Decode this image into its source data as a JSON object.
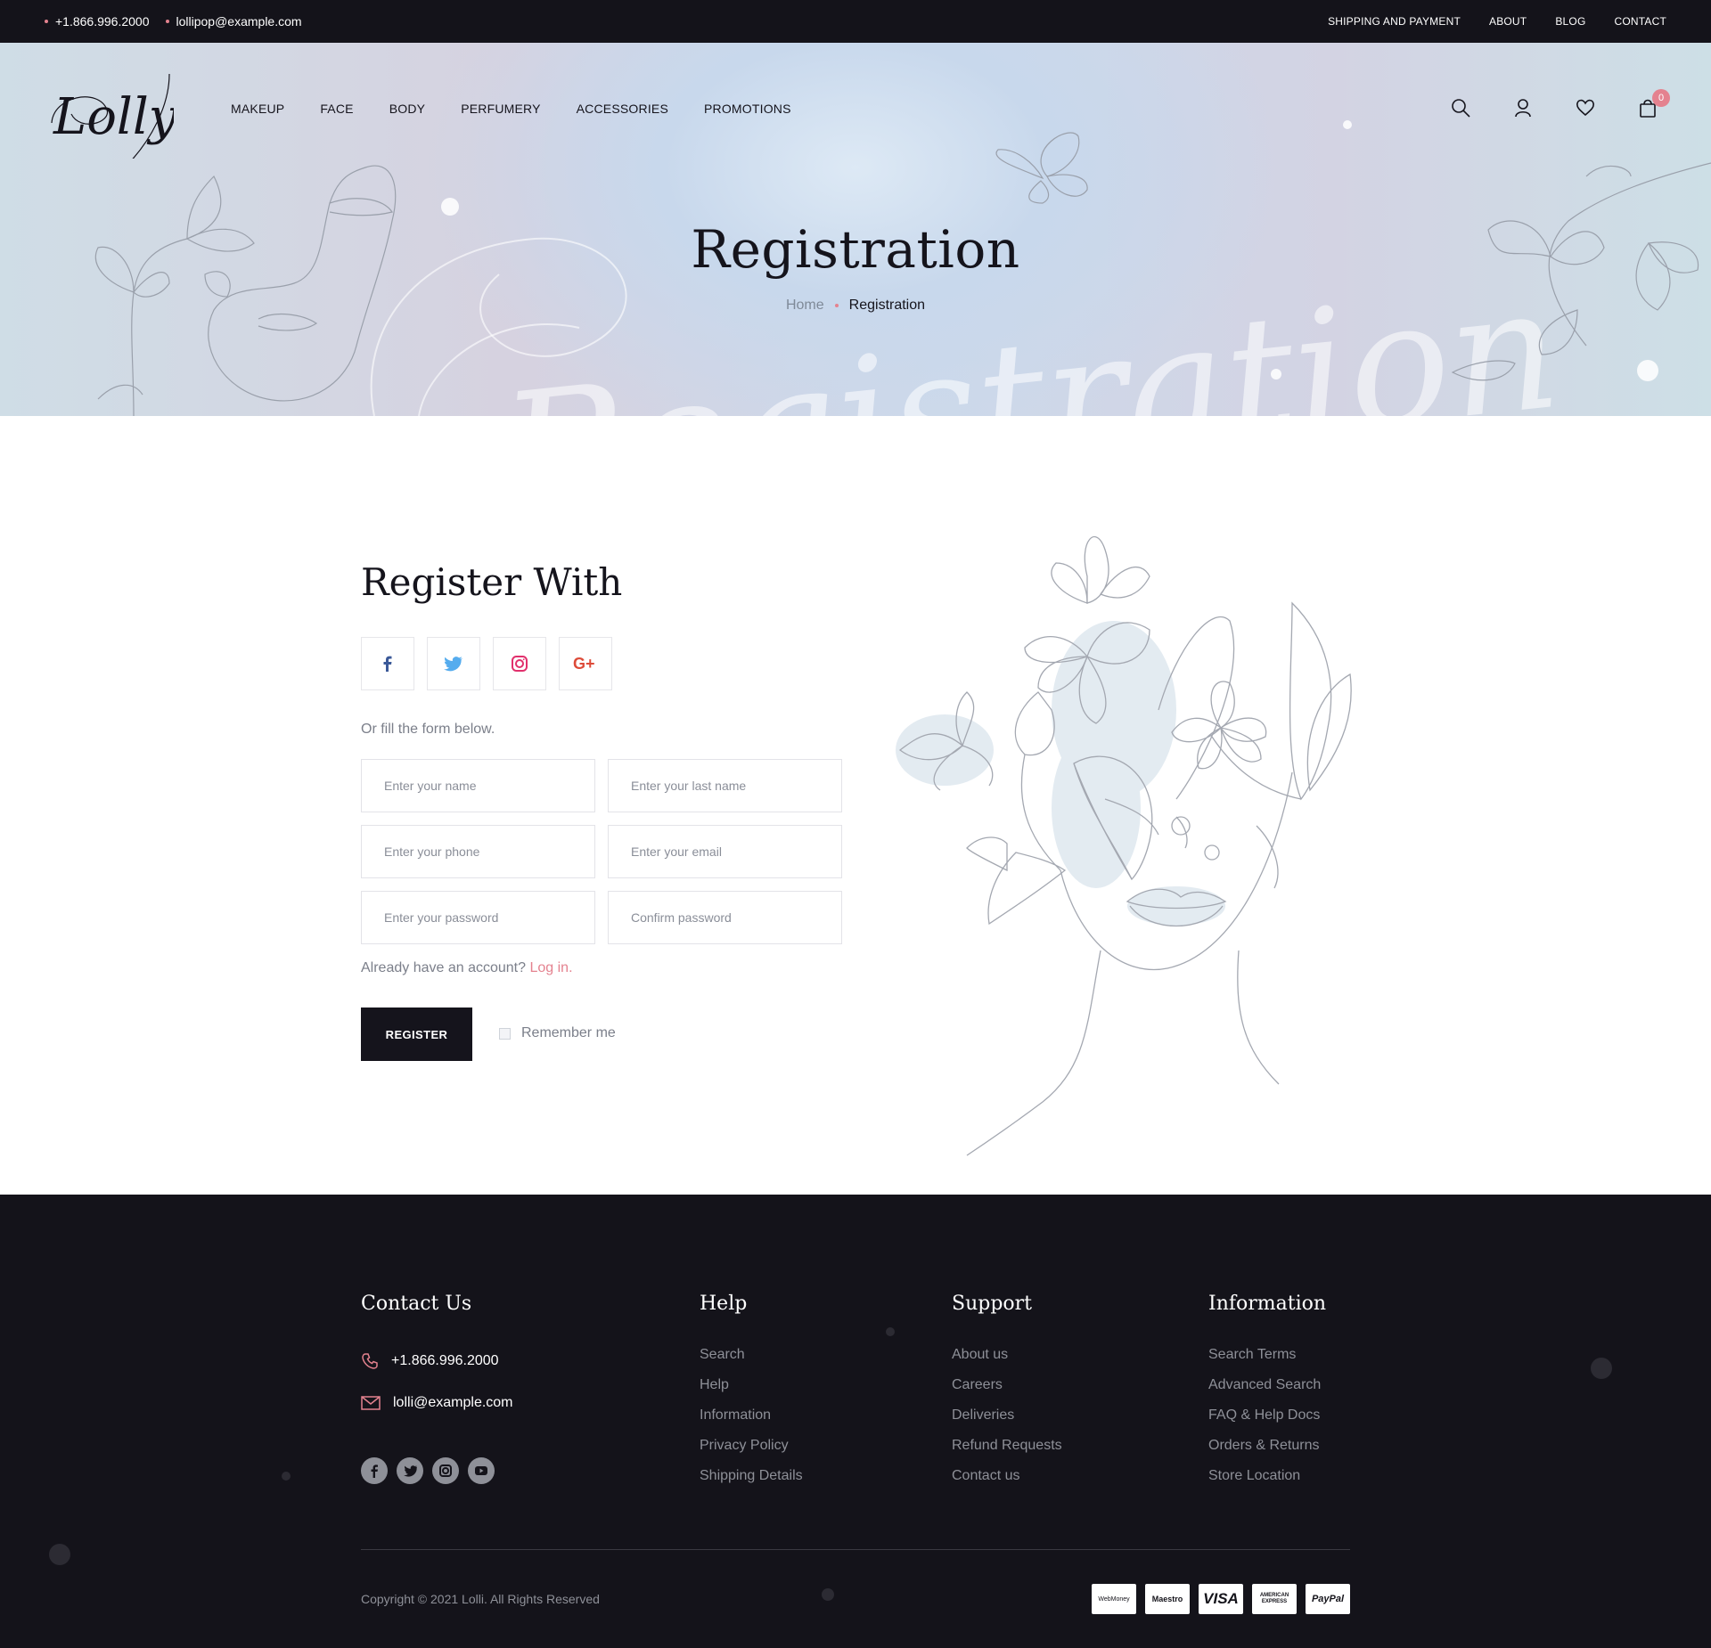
{
  "topbar": {
    "phone": "+1.866.996.2000",
    "email": "lollipop@example.com",
    "links": [
      "SHIPPING AND PAYMENT",
      "ABOUT",
      "BLOG",
      "CONTACT"
    ]
  },
  "header": {
    "logo_text": "Lolly",
    "nav": [
      "MAKEUP",
      "FACE",
      "BODY",
      "PERFUMERY",
      "ACCESSORIES",
      "PROMOTIONS"
    ],
    "icons": [
      "search-icon",
      "user-icon",
      "heart-icon",
      "cart-icon"
    ],
    "cart_count": "0"
  },
  "hero": {
    "title": "Registration",
    "watermark": "Registration",
    "breadcrumb_home": "Home",
    "breadcrumb_current": "Registration"
  },
  "register": {
    "title": "Register With",
    "social": [
      "facebook-icon",
      "twitter-icon",
      "instagram-icon",
      "google-plus-icon"
    ],
    "note": "Or fill the form below.",
    "fields": {
      "name": "Enter your name",
      "last_name": "Enter your last name",
      "phone": "Enter your phone",
      "email": "Enter your email",
      "password": "Enter your password",
      "confirm": "Confirm password"
    },
    "have_account": "Already have an account?",
    "login": "Log in.",
    "button": "REGISTER",
    "remember": "Remember me"
  },
  "footer": {
    "contact": {
      "title": "Contact Us",
      "phone": "+1.866.996.2000",
      "email": "lolli@example.com"
    },
    "help": {
      "title": "Help",
      "items": [
        "Search",
        "Help",
        "Information",
        "Privacy Policy",
        "Shipping Details"
      ]
    },
    "support": {
      "title": "Support",
      "items": [
        "About us",
        "Careers",
        "Deliveries",
        "Refund Requests",
        "Contact us"
      ]
    },
    "information": {
      "title": "Information",
      "items": [
        "Search Terms",
        "Advanced Search",
        "FAQ & Help Docs",
        "Orders & Returns",
        "Store Location"
      ]
    },
    "copyright": "Copyright © 2021 Lolli.  All Rights Reserved",
    "payments": [
      "WebMoney",
      "Maestro",
      "VISA",
      "AMERICAN EXPRESS",
      "PayPal"
    ]
  },
  "colors": {
    "accent": "#e4828f",
    "dark": "#14131a",
    "muted": "#8e9098"
  }
}
